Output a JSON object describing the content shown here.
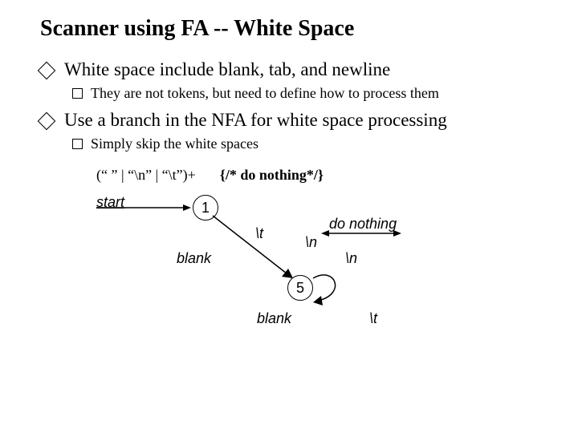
{
  "title": "Scanner using FA -- White Space",
  "bullets": {
    "b1": "White space include blank, tab, and newline",
    "b1a": "They are not tokens, but need to define how to process them",
    "b2": "Use a branch in the NFA for white space processing",
    "b2a": "Simply skip the white spaces"
  },
  "rule": {
    "lhs": "(“ ” | “\\n” | “\\t”)+",
    "rhs": "{/* do nothing*/}"
  },
  "diagram": {
    "start": "start",
    "state1": "1",
    "state5": "5",
    "blank_top": "blank",
    "blank_bottom": "blank",
    "tab_top": "\\t",
    "tab_bottom": "\\t",
    "nl_top": "\\n",
    "nl_bottom": "\\n",
    "do_nothing": "do nothing"
  }
}
